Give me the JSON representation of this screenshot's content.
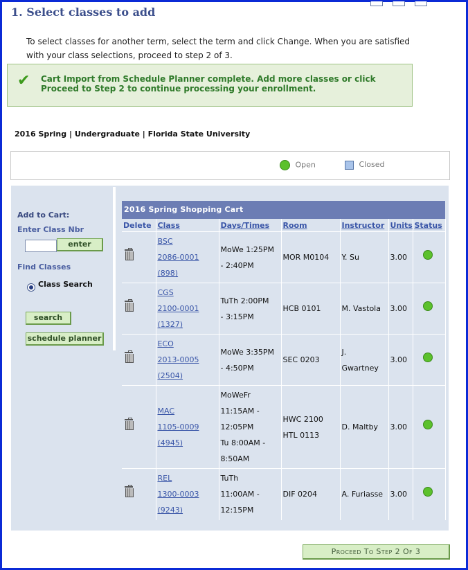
{
  "page": {
    "title": "1.  Select classes to add",
    "intro": "To select classes for another term, select the term and click Change.  When you are satisfied with your class selections, proceed to step 2 of 3."
  },
  "message": {
    "text": "Cart Import from Schedule Planner complete. Add more classes or click Proceed to Step 2 to continue processing your enrollment."
  },
  "term": "2016 Spring | Undergraduate | Florida State University",
  "legend": {
    "open": "Open",
    "closed": "Closed"
  },
  "sidebar": {
    "add_to_cart": "Add to Cart:",
    "enter_class_nbr": "Enter Class Nbr",
    "enter_button": "enter",
    "find_classes": "Find Classes",
    "class_search": "Class Search",
    "search_button": "search",
    "schedule_planner_button": "schedule planner"
  },
  "cart": {
    "title": "2016 Spring Shopping Cart",
    "columns": [
      "Delete",
      "Class",
      "Days/Times",
      "Room",
      "Instructor",
      "Units",
      "Status"
    ],
    "rows": [
      {
        "class_subject": "BSC",
        "class_number": "2086-0001",
        "class_id": "(898)",
        "days_times": [
          "MoWe 1:25PM",
          "- 2:40PM"
        ],
        "room": [
          "MOR M0104"
        ],
        "instructor": [
          "Y. Su"
        ],
        "units": "3.00",
        "status": "Open"
      },
      {
        "class_subject": "CGS",
        "class_number": "2100-0001",
        "class_id": "(1327)",
        "days_times": [
          "TuTh 2:00PM",
          "- 3:15PM"
        ],
        "room": [
          "HCB 0101"
        ],
        "instructor": [
          "M. Vastola"
        ],
        "units": "3.00",
        "status": "Open"
      },
      {
        "class_subject": "ECO",
        "class_number": "2013-0005",
        "class_id": "(2504)",
        "days_times": [
          "MoWe 3:35PM",
          "- 4:50PM"
        ],
        "room": [
          "SEC 0203"
        ],
        "instructor": [
          "J.",
          "Gwartney"
        ],
        "units": "3.00",
        "status": "Open"
      },
      {
        "class_subject": "MAC",
        "class_number": "1105-0009",
        "class_id": "(4945)",
        "days_times": [
          "MoWeFr",
          "11:15AM -",
          "12:05PM",
          "Tu 8:00AM -",
          "8:50AM"
        ],
        "room": [
          "HWC 2100",
          "HTL 0113"
        ],
        "instructor": [
          "D. Maltby"
        ],
        "units": "3.00",
        "status": "Open"
      },
      {
        "class_subject": "REL",
        "class_number": "1300-0003",
        "class_id": "(9243)",
        "days_times": [
          "TuTh",
          "11:00AM -",
          "12:15PM"
        ],
        "room": [
          "DIF 0204"
        ],
        "instructor": [
          "A. Furiasse"
        ],
        "units": "3.00",
        "status": "Open"
      }
    ]
  },
  "proceed_button": "Proceed To Step 2 Of 3",
  "colors": {
    "open_status": "#5cc12c",
    "closed_status": "#a9c4ea",
    "cart_header": "#6c7db4",
    "message_text": "#2f7a2a"
  }
}
